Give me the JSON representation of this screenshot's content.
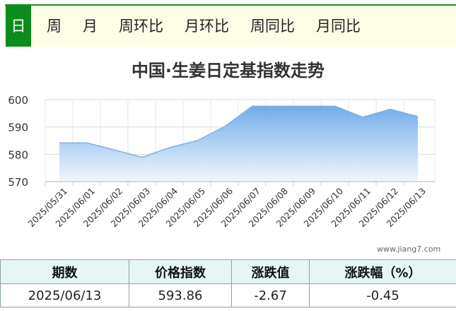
{
  "tabs": [
    {
      "label": "日",
      "active": true
    },
    {
      "label": "周",
      "active": false
    },
    {
      "label": "月",
      "active": false
    },
    {
      "label": "周环比",
      "active": false
    },
    {
      "label": "月环比",
      "active": false
    },
    {
      "label": "周同比",
      "active": false
    },
    {
      "label": "月同比",
      "active": false
    }
  ],
  "colors": {
    "accent": "#0c8c1c",
    "series_line": "#7fb0e6",
    "area_top": "#6aa8e6",
    "area_bottom": "#eef5fd",
    "table_header_bg": "#e5f7f5"
  },
  "watermark": "www.jiang7.com",
  "chart_data": {
    "type": "area",
    "title": "中国·生姜日定基指数走势",
    "x": [
      "2025/05/31",
      "2025/06/01",
      "2025/06/02",
      "2025/06/03",
      "2025/06/04",
      "2025/06/05",
      "2025/06/06",
      "2025/06/07",
      "2025/06/08",
      "2025/06/09",
      "2025/06/10",
      "2025/06/11",
      "2025/06/12",
      "2025/06/13"
    ],
    "series": [
      {
        "values": [
          584.2,
          584.2,
          581.6,
          578.9,
          582.5,
          585.0,
          590.2,
          597.6,
          597.6,
          597.6,
          597.6,
          593.6,
          596.5,
          593.86
        ]
      }
    ],
    "yticks": [
      570,
      580,
      590,
      600
    ],
    "ylim": [
      570,
      600
    ],
    "grid": true
  },
  "table": {
    "headers": [
      "期数",
      "价格指数",
      "涨跌值",
      "涨跌幅（%）"
    ],
    "rows": [
      [
        "2025/06/13",
        "593.86",
        "-2.67",
        "-0.45"
      ]
    ]
  }
}
